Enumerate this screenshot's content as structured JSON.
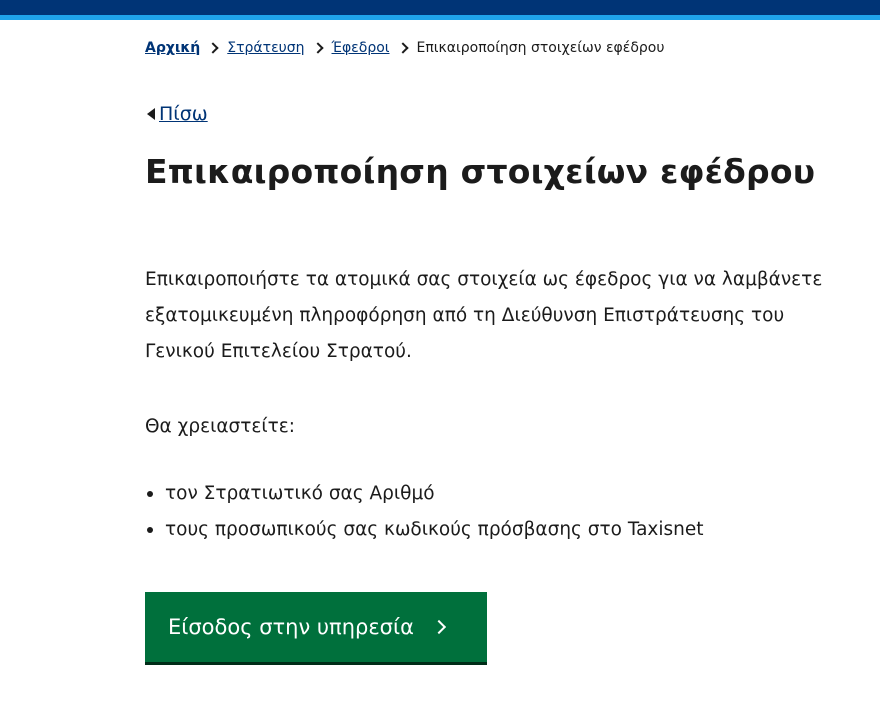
{
  "breadcrumb": {
    "items": [
      "Αρχική",
      "Στράτευση",
      "Έφεδροι"
    ],
    "current": "Επικαιροποίηση στοιχείων εφέδρου"
  },
  "back": {
    "label": "Πίσω"
  },
  "page": {
    "title": "Επικαιροποίηση στοιχείων εφέδρου",
    "intro": "Επικαιροποιήστε τα ατομικά σας στοιχεία ως έφεδρος για να λαμβάνετε εξατομικευμένη πληροφόρηση από τη Διεύθυνση Επιστράτευσης του Γενικού Επιτελείου Στρατού.",
    "need_label": "Θα χρειαστείτε:",
    "requirements": [
      "τον Στρατιωτικό σας Αριθμό",
      "τους προσωπικούς σας κωδικούς πρόσβασης στο Taxisnet"
    ]
  },
  "button": {
    "label": "Είσοδος στην υπηρεσία"
  },
  "colors": {
    "header": "#003476",
    "header_accent": "#1fa3ea",
    "link": "#003476",
    "button": "#00703c"
  }
}
